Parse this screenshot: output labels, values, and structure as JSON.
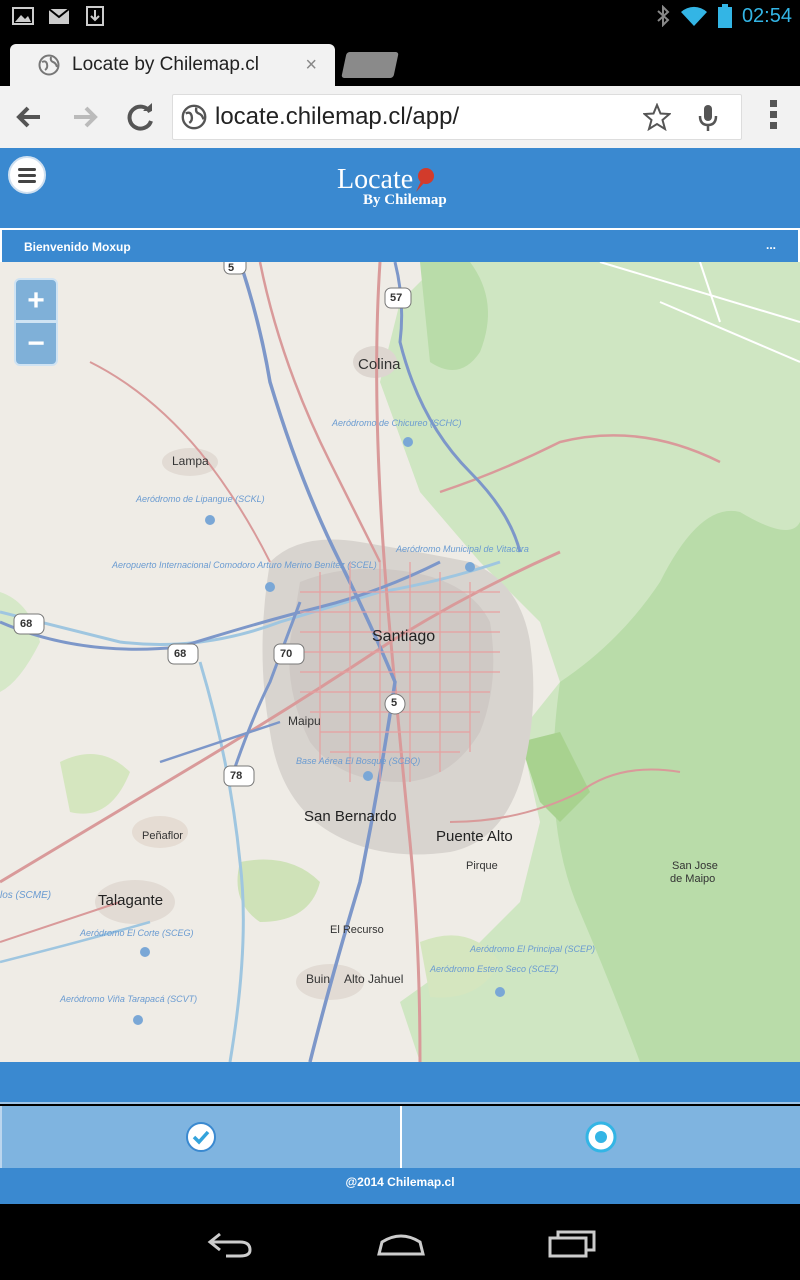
{
  "status_bar": {
    "time": "02:54",
    "left_icons": [
      "image-icon",
      "gmail-icon",
      "download-icon"
    ],
    "right_icons": [
      "bluetooth-icon",
      "wifi-icon",
      "battery-icon"
    ]
  },
  "browser": {
    "tab_title": "Locate by Chilemap.cl",
    "close_symbol": "×",
    "url": "locate.chilemap.cl/app/"
  },
  "app": {
    "logo_main": "Locate",
    "logo_sub": "By Chilemap",
    "welcome_text": "Bienvenido Moxup",
    "welcome_menu": "...",
    "footer": "@2014 Chilemap.cl"
  },
  "map": {
    "zoom_in": "+",
    "zoom_out": "−",
    "places": {
      "colina": "Colina",
      "lampa": "Lampa",
      "santiago": "Santiago",
      "maipu": "Maipu",
      "san_bernardo": "San Bernardo",
      "puente_alto": "Puente Alto",
      "pirque": "Pirque",
      "penaflor": "Peñaflor",
      "talagante": "Talagante",
      "el_recurso": "El Recurso",
      "buin": "Buin",
      "alto_jahuel": "Alto Jahuel",
      "san_jose_1": "San Jose",
      "san_jose_2": "de Maipo",
      "scme": "los (SCME)"
    },
    "airports": {
      "chicureo": "Aeródromo de Chicureo (SCHC)",
      "lipangue": "Aeródromo de Lipangue (SCKL)",
      "vitacura": "Aeródromo Municipal de Vitacura",
      "merino": "Aeropuerto Internacional Comodoro Arturo Merino Benítez (SCEL)",
      "bosque": "Base Aérea El Bosque (SCBQ)",
      "corte": "Aeródromo El Corte (SCEG)",
      "principal": "Aeródromo El Principal (SCEP)",
      "estero": "Aeródromo Estero Seco (SCEZ)",
      "tarapaca": "Aeródromo Viña Tarapacá (SCVT)"
    },
    "shields": {
      "r5a": "5",
      "r57": "57",
      "r68a": "68",
      "r68b": "68",
      "r70": "70",
      "r5b": "5",
      "r78": "78"
    }
  },
  "colors": {
    "app_blue": "#3a89d0",
    "button_blue": "#7fb4e0",
    "accent": "#33b5e5"
  }
}
